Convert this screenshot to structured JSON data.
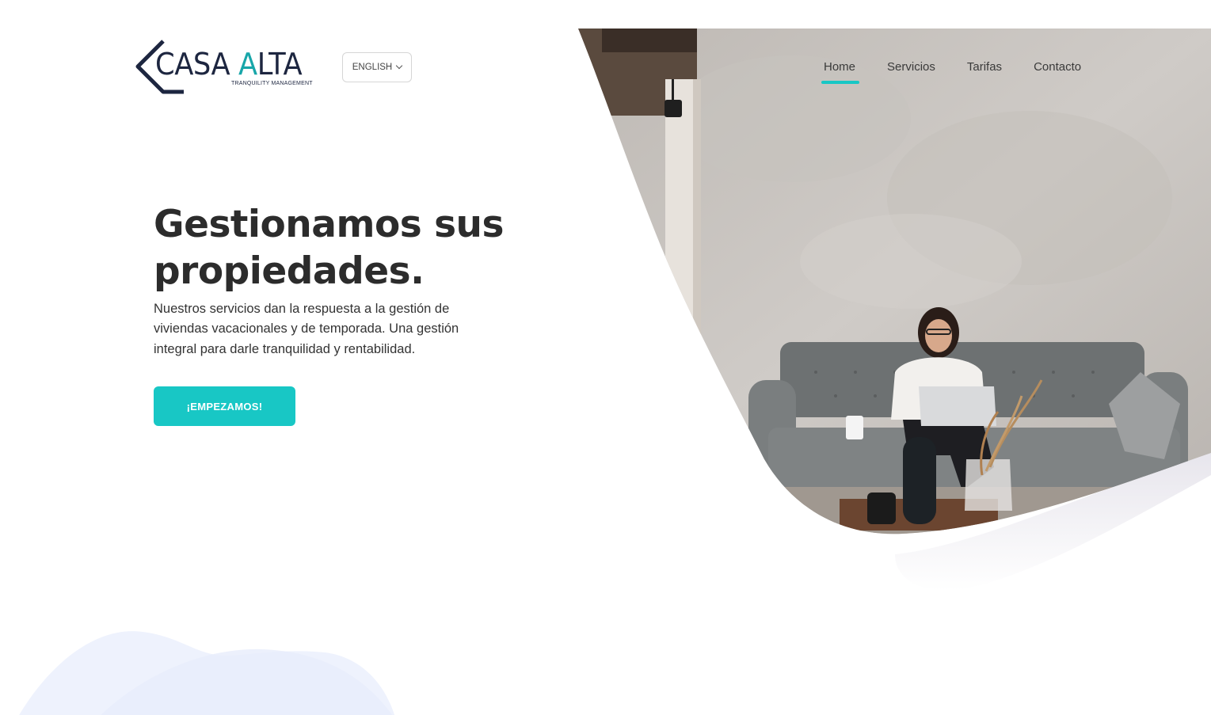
{
  "brand": {
    "name_part1": "CASA ",
    "name_accent": "A",
    "name_part2": "LTA",
    "tagline": "TRANQUILITY MANAGEMENT"
  },
  "language": {
    "selected": "ENGLISH",
    "icon": "chevron-down-icon"
  },
  "nav": {
    "items": [
      {
        "label": "Home",
        "active": true
      },
      {
        "label": "Servicios",
        "active": false
      },
      {
        "label": "Tarifas",
        "active": false
      },
      {
        "label": "Contacto",
        "active": false
      }
    ]
  },
  "hero": {
    "title_line1": "Gestionamos sus",
    "title_line2": "propiedades.",
    "description": "Nuestros servicios dan la respuesta a la gestión de viviendas vacacionales y de temporada. Una gestión integral para darle tranquilidad y rentabilidad.",
    "cta_label": "¡EMPEZAMOS!"
  },
  "colors": {
    "accent": "#18c7c5",
    "brand_dark": "#1d2640",
    "brand_teal": "#18a6a9"
  }
}
